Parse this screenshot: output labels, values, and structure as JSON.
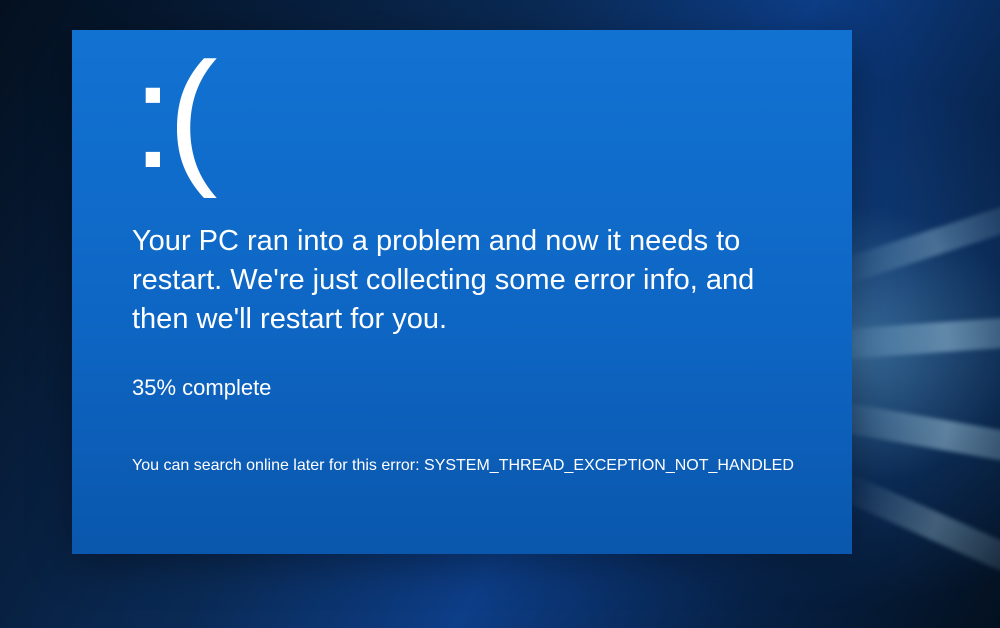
{
  "bsod": {
    "sad_face": ":(",
    "message": "Your PC ran into a problem and now it needs to restart. We're just collecting some error info, and then we'll restart for you.",
    "progress": "35% complete",
    "footer_prefix": "You can search online later for this error: ",
    "error_code": "SYSTEM_THREAD_EXCEPTION_NOT_HANDLED"
  }
}
